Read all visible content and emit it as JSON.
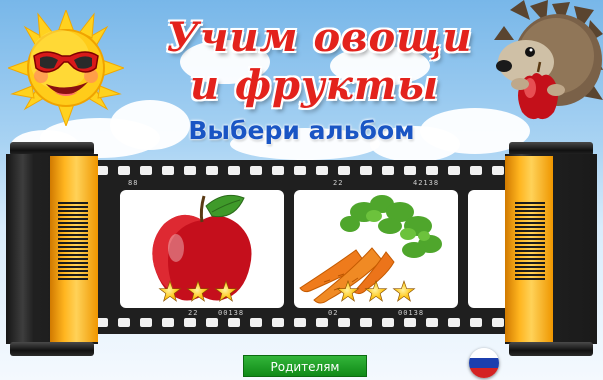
{
  "title": {
    "line1": "Учим овощи",
    "line2": "и фрукты"
  },
  "subtitle": "Выбери альбом",
  "albums": [
    {
      "name": "apple-album",
      "stars": 3,
      "max_stars": 3
    },
    {
      "name": "carrot-album",
      "stars": 3,
      "max_stars": 3
    }
  ],
  "film_codes": [
    "88",
    "22",
    "00138",
    "02",
    "42138"
  ],
  "parents_button": "Родителям",
  "language_flag": "russia-flag-icon",
  "mascots": [
    "sun-with-sunglasses",
    "hedgehog-with-apple"
  ],
  "colors": {
    "title": "#e3221c",
    "subtitle": "#1a55c4",
    "button": "#1a9e22",
    "reel_accent": "#ffb51f"
  }
}
